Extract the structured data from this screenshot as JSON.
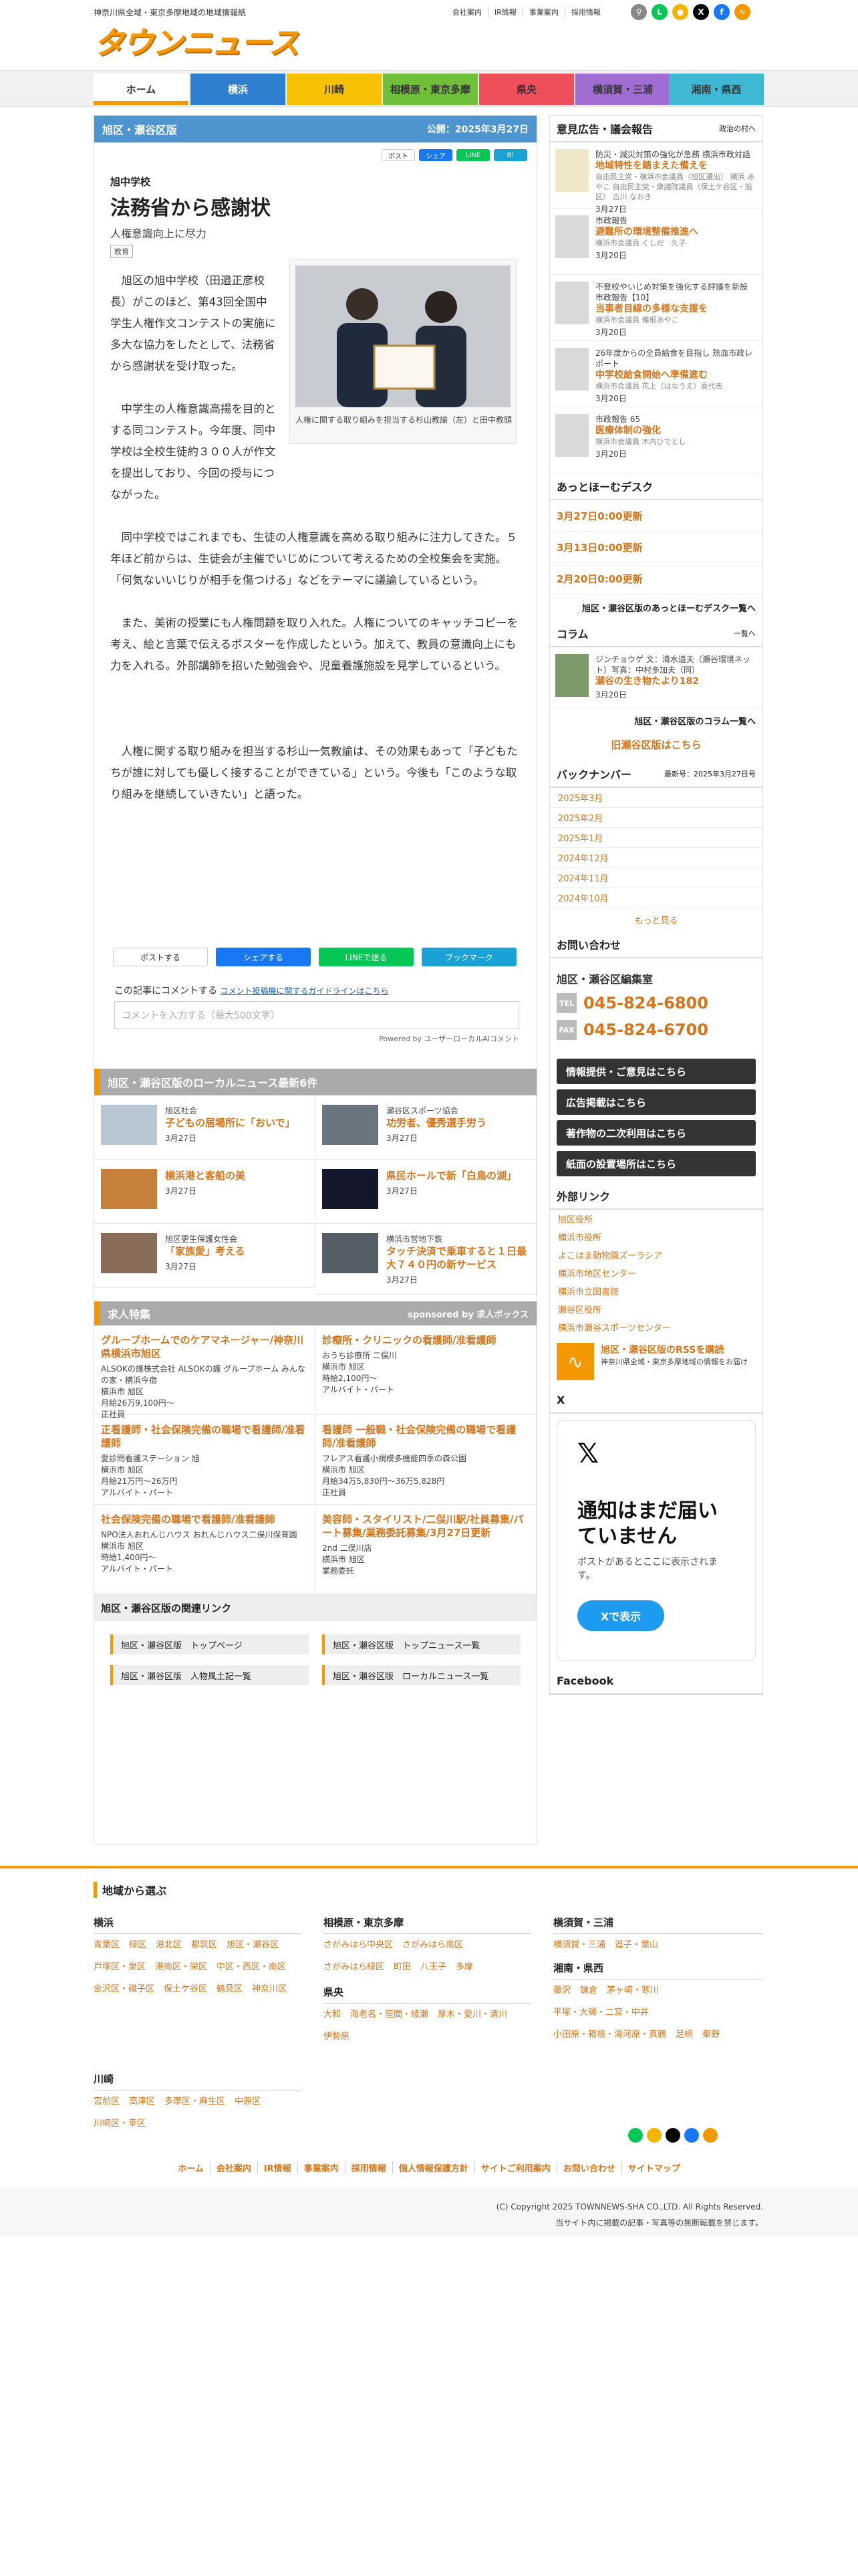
{
  "header": {
    "tagline": "神奈川県全域・東京多摩地域の地域情報紙",
    "logo_text": "タウンニュース",
    "top_links": [
      "会社案内",
      "IR情報",
      "事業案内",
      "採用情報"
    ]
  },
  "nav": {
    "tabs": [
      {
        "label": "ホーム",
        "color": "#f39800"
      },
      {
        "label": "横浜",
        "color": "#2f7fd1"
      },
      {
        "label": "川崎",
        "color": "#f5c100"
      },
      {
        "label": "相模原・東京多摩",
        "color": "#6fbf3a"
      },
      {
        "label": "県央",
        "color": "#ef4e5b"
      },
      {
        "label": "横須賀・三浦",
        "color": "#a06dd2"
      },
      {
        "label": "湘南・県西",
        "color": "#3fb8d6"
      }
    ]
  },
  "article": {
    "area": "旭区・瀬谷区版",
    "published": "公開：2025年3月27日",
    "school": "旭中学校",
    "title": "法務省から感謝状",
    "subtitle": "人権意識向上に尽力",
    "badge": "教育",
    "share_small": [
      "ポスト",
      "シェア",
      "LINE",
      "B!"
    ],
    "p1": "旭区の旭中学校（田邉正彦校長）がこのほど、第43回全国中学生人権作文コンテストの実施に多大な協力をしたとして、法務省から感謝状を受け取った。",
    "p2": "中学生の人権意識高揚を目的とする同コンテスト。今年度、同中学校は全校生徒約３００人が作文を提出しており、今回の授与につながった。",
    "p3": "同中学校ではこれまでも、生徒の人権意識を高める取り組みに注力してきた。５年ほど前からは、生徒会が主催でいじめについて考えるための全校集会を実施。「何気ないいじりが相手を傷つける」などをテーマに議論しているという。",
    "p4": "また、美術の授業にも人権問題を取り入れた。人権についてのキャッチコピーを考え、絵と言葉で伝えるポスターを作成したという。加えて、教員の意識向上にも力を入れる。外部講師を招いた勉強会や、児童養護施設を見学しているという。",
    "p5": "人権に関する取り組みを担当する杉山一気教諭は、その効果もあって「子どもたちが誰に対しても優しく接することができている」という。今後も「このような取り組みを継続していきたい」と語った。",
    "photo_caption": "人権に関する取り組みを担当する杉山教諭（左）と田中教頭",
    "share_big": [
      "ポストする",
      "シェアする",
      "LINEで送る",
      "ブックマーク"
    ],
    "comment_label": "この記事にコメントする",
    "comment_guide": "コメント投稿機に関するガイドラインはこちら",
    "comment_placeholder": "コメントを入力する（最大500文字）",
    "powered": "Powered by ユーザーローカルAIコメント"
  },
  "local_news": {
    "heading": "旭区・瀬谷区版のローカルニュース最新6件",
    "items": [
      {
        "cat": "旭区社会",
        "headline": "子どもの居場所に「おいで」",
        "date": "3月27日"
      },
      {
        "cat": "瀬谷区スポーツ協会",
        "headline": "功労者、優秀選手労う",
        "date": "3月27日"
      },
      {
        "cat": "",
        "headline": "横浜港と客船の美",
        "date": "3月27日"
      },
      {
        "cat": "",
        "headline": "県民ホールで新「白鳥の湖」",
        "date": "3月27日"
      },
      {
        "cat": "旭区更生保護女性会",
        "headline": "「家族愛」考える",
        "date": "3月27日"
      },
      {
        "cat": "横浜市営地下鉄",
        "headline": "タッチ決済で乗車すると１日最大７４０円の新サービス",
        "date": "3月27日"
      }
    ]
  },
  "jobs": {
    "heading": "求人特集",
    "sponsor": "sponsored by 求人ボックス",
    "items": [
      {
        "title": "グループホームでのケアマネージャー/神奈川県横浜市旭区",
        "org": "ALSOKの護株式会社 ALSOKの護 グループホーム みんなの家・横浜今宿",
        "place": "横浜市 旭区",
        "pay": "月給26万9,100円～",
        "type": "正社員"
      },
      {
        "title": "診療所・クリニックの看護師/准看護師",
        "org": "おうち診療所 二俣川",
        "place": "横浜市 旭区",
        "pay": "時給2,100円～",
        "type": "アルバイト・パート"
      },
      {
        "title": "正看護師・社会保険完備の職場で看護師/准看護師",
        "org": "愛診問看護ステーション 旭",
        "place": "横浜市 旭区",
        "pay": "月給21万円～26万円",
        "type": "アルバイト・パート"
      },
      {
        "title": "看護師 一般職・社会保険完備の職場で看護師/准看護師",
        "org": "フレアス看護小規模多機能四季の森公園",
        "place": "横浜市 旭区",
        "pay": "月給34万5,830円～36万5,828円",
        "type": "正社員"
      },
      {
        "title": "社会保険完備の職場で看護師/准看護師",
        "org": "NPO法人おれんじハウス おれんじハウス二俣川保育園",
        "place": "横浜市 旭区",
        "pay": "時給1,400円～",
        "type": "アルバイト・パート"
      },
      {
        "title": "美容師・スタイリスト/二俣川駅/社員募集/パート募集/業務委託募集/3月27日更新",
        "org": "2nd 二俣川店",
        "place": "横浜市 旭区",
        "pay": "業務委託",
        "type": ""
      }
    ]
  },
  "related": {
    "heading": "旭区・瀬谷区版の関連リンク",
    "links": [
      "旭区・瀬谷区版　トップページ",
      "旭区・瀬谷区版　トップニュース一覧",
      "旭区・瀬谷区版　人物風土記一覧",
      "旭区・瀬谷区版　ローカルニュース一覧"
    ]
  },
  "sidebar": {
    "opinion_heading": "意見広告・議会報告",
    "opinion_more": "政治の村へ",
    "opinions": [
      {
        "t1": "防災・減災対策の強化が急務 横浜市政対話",
        "t2": "地域特性を踏まえた備えを",
        "t3": "自由民主党・横浜市会議員（旭区選出） 横浜 あやこ 自由民主党・衆議院議員（保土ケ谷区・旭区） 古川 なおき",
        "date": "3月27日"
      },
      {
        "t1": "市政報告",
        "t2": "避難所の環境整備推進へ",
        "t3": "横浜市会議員 くしだ　久子",
        "date": "3月20日"
      },
      {
        "t1": "不登校やいじめ対策を強化する評議を新設 市政報告【10】",
        "t2": "当事者目線の多様な支援を",
        "t3": "横浜市会議員 備根あやこ",
        "date": "3月20日"
      },
      {
        "t1": "26年度からの全員給食を目指し 熱血市政レポート",
        "t2": "中学校給食開始へ準備進む",
        "t3": "横浜市会議員 花上（はなうえ）喜代志",
        "date": "3月20日"
      },
      {
        "t1": "市政報告 65",
        "t2": "医療体制の強化",
        "t3": "横浜市会議員 木内ひでとし",
        "date": "3月20日"
      }
    ],
    "desk_heading": "あっとほーむデスク",
    "desk_items": [
      "3月27日0:00更新",
      "3月13日0:00更新",
      "2月20日0:00更新"
    ],
    "desk_more": "旭区・瀬谷区版のあっとほーむデスク一覧へ",
    "column_heading": "コラム",
    "column_more_top": "一覧へ",
    "column": {
      "t1": "ジンチョウゲ 文：清水道夫（瀬谷環境ネット）写真：中村多加夫（同）",
      "t2": "瀬谷の生き物たより182",
      "date": "3月20日"
    },
    "column_more": "旭区・瀬谷区版のコラム一覧へ",
    "old_link": "旧瀬谷区版はこちら",
    "backnum_heading": "バックナンバー",
    "backnum_latest": "最新号：2025年3月27日号",
    "backnum": [
      "2025年3月",
      "2025年2月",
      "2025年1月",
      "2024年12月",
      "2024年11月",
      "2024年10月"
    ],
    "backnum_more": "もっと見る",
    "contact_heading": "お問い合わせ",
    "contact_name": "旭区・瀬谷区編集室",
    "tel": "045-824-6800",
    "fax": "045-824-6700",
    "tel_label": "TEL",
    "fax_label": "FAX",
    "buttons": [
      "情報提供・ご意見はこちら",
      "広告掲載はこちら",
      "著作物の二次利用はこちら",
      "紙面の設置場所はこちら"
    ],
    "ext_heading": "外部リンク",
    "ext_links": [
      "旭区役所",
      "横浜市役所",
      "よこはま動物園ズーラシア",
      "横浜市地区センター",
      "横浜市立図書館",
      "瀬谷区役所",
      "横浜市瀬谷スポーツセンター"
    ],
    "rss_title": "旭区・瀬谷区版のRSSを購読",
    "rss_sub": "神奈川県全域・東京多摩地域の情報をお届け",
    "x_heading": "X",
    "x_title": "通知はまだ届いていません",
    "x_sub": "ポストがあるとここに表示されます。",
    "x_button": "Xで表示",
    "fb_heading": "Facebook"
  },
  "footer": {
    "heading": "地域から選ぶ",
    "cols": [
      {
        "h": "横浜",
        "links": [
          "青葉区",
          "緑区",
          "港北区",
          "都筑区",
          "旭区・瀬谷区",
          "戸塚区・泉区",
          "港南区・栄区",
          "中区・西区・南区",
          "金沢区・磯子区",
          "保土ケ谷区",
          "鶴見区",
          "神奈川区"
        ]
      },
      {
        "h": "川崎",
        "links": [
          "宮前区",
          "高津区",
          "多摩区・麻生区",
          "中原区",
          "川崎区・幸区"
        ]
      },
      {
        "h": "相模原・東京多摩",
        "links": [
          "さがみはら中央区",
          "さがみはら南区",
          "さがみはら緑区",
          "町田",
          "八王子",
          "多摩"
        ]
      },
      {
        "h": "県央",
        "links": [
          "大和",
          "海老名・座間・綾瀬",
          "厚木・愛川・清川",
          "伊勢原"
        ]
      },
      {
        "h": "横須賀・三浦",
        "links": [
          "横須賀・三浦",
          "逗子・葉山"
        ]
      },
      {
        "h": "湘南・県西",
        "links": [
          "藤沢",
          "鎌倉",
          "茅ヶ崎・寒川",
          "平塚・大磯・二宮・中井",
          "小田原・箱根・湯河原・真鶴",
          "足柄",
          "秦野"
        ]
      }
    ],
    "nav": [
      "ホーム",
      "会社案内",
      "IR情報",
      "事業案内",
      "採用情報",
      "個人情報保護方針",
      "サイトご利用案内",
      "お問い合わせ",
      "サイトマップ"
    ],
    "copyright": "(C) Copyright 2025 TOWNNEWS-SHA CO.,LTD. All Rights Reserved.",
    "notice": "当サイト内に掲載の記事・写真等の無断転載を禁じます。"
  }
}
